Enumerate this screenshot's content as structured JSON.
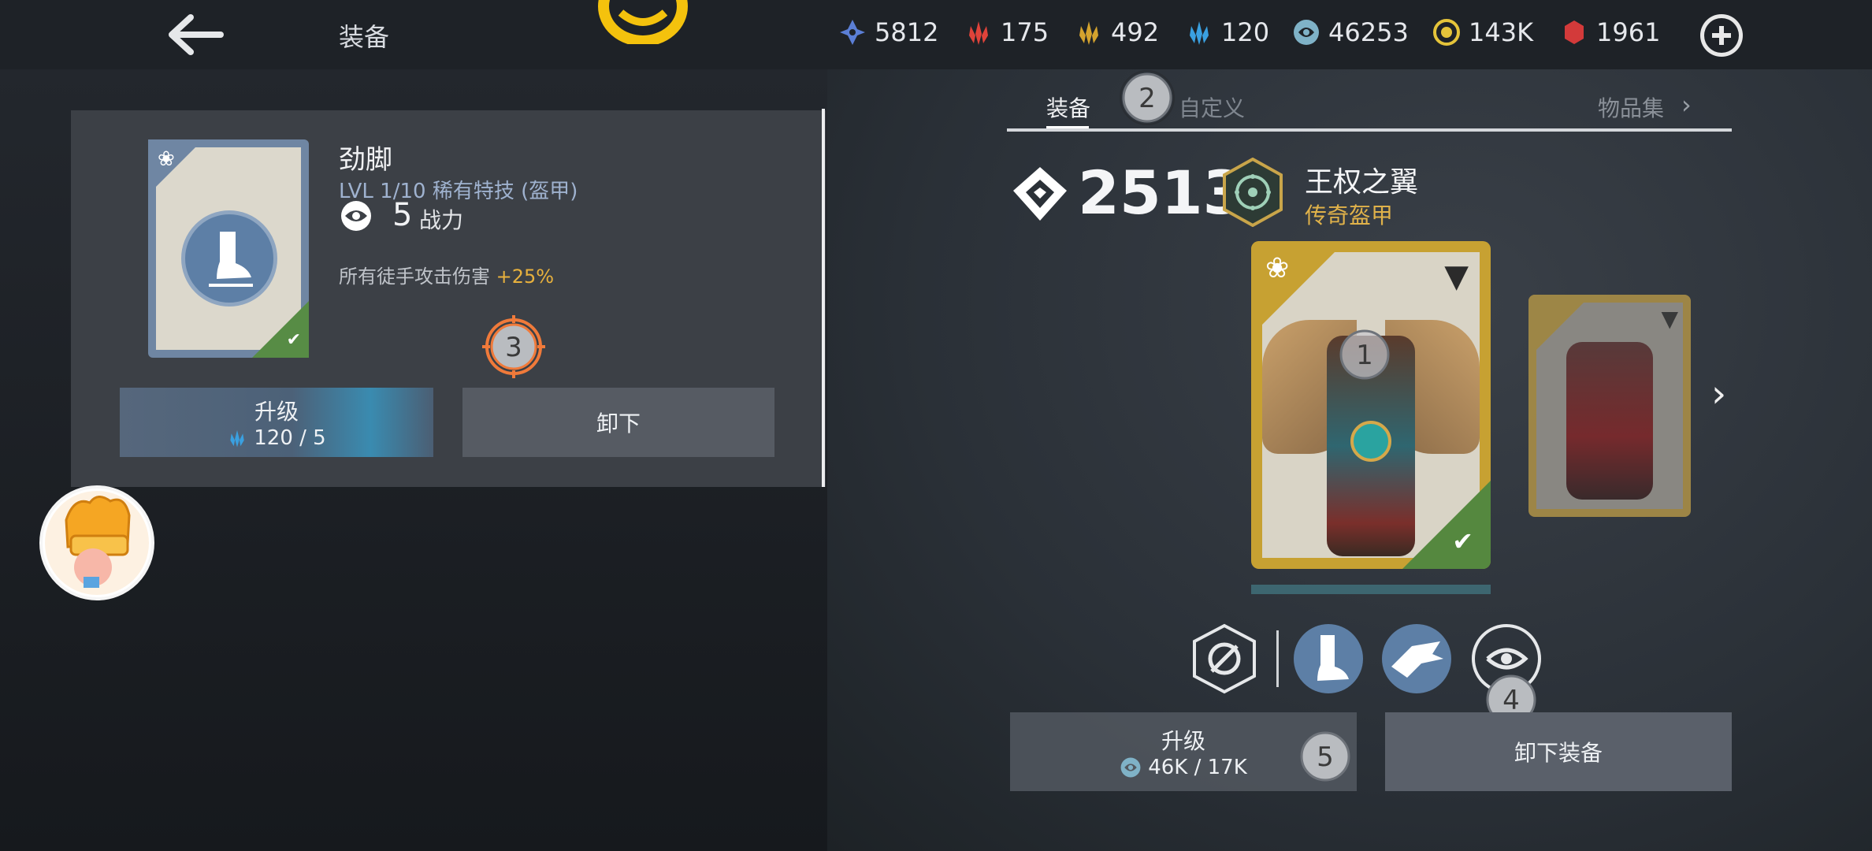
{
  "header": {
    "title": "装备",
    "resources": [
      {
        "name": "diamond",
        "value": "5812",
        "color": "#5b7fd6"
      },
      {
        "name": "red-crystal",
        "value": "175",
        "color": "#e0433a"
      },
      {
        "name": "gold-crystal",
        "value": "492",
        "color": "#d4a32e"
      },
      {
        "name": "blue-crystal",
        "value": "120",
        "color": "#3aa0e0"
      },
      {
        "name": "steel",
        "value": "46253",
        "color": "#7fb2c7"
      },
      {
        "name": "coin",
        "value": "143K",
        "color": "#e5c43a"
      },
      {
        "name": "ruby",
        "value": "1961",
        "color": "#d33a3a"
      }
    ]
  },
  "skill": {
    "name": "劲脚",
    "meta": "LVL  1/10  稀有特技 (盔甲)",
    "power_value": "5",
    "power_label": "战力",
    "effect_text": "所有徒手攻击伤害 ",
    "effect_bonus": "+25%",
    "upgrade_label": "升级",
    "upgrade_cost": "120 / 5",
    "unequip_label": "卸下"
  },
  "tabs": {
    "equip": "装备",
    "custom": "自定义",
    "collection": "物品集"
  },
  "gear": {
    "score": "2513",
    "name": "王权之翼",
    "rarity": "传奇盔甲",
    "upgrade_label": "升级",
    "upgrade_cost": "46K / 17K",
    "unequip_label": "卸下装备"
  },
  "markers": [
    "1",
    "2",
    "3",
    "4",
    "5"
  ],
  "colors": {
    "accent_gold": "#e0b24a",
    "bonus": "#e8b13d",
    "check_green": "#578c45"
  }
}
